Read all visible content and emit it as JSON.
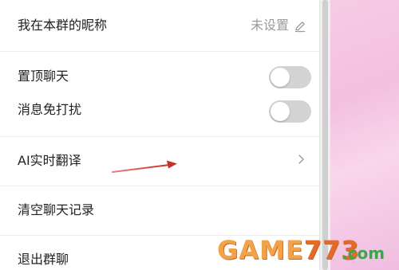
{
  "settings": {
    "nickname": {
      "label": "我在本群的昵称",
      "value": "未设置"
    },
    "pin_chat": {
      "label": "置顶聊天",
      "enabled": false
    },
    "do_not_disturb": {
      "label": "消息免打扰",
      "enabled": false
    },
    "ai_translate": {
      "label": "AI实时翻译"
    },
    "clear_history": {
      "label": "清空聊天记录"
    },
    "exit_group": {
      "label": "退出群聊"
    }
  },
  "icons": {
    "edit": "pencil-icon",
    "chevron": "chevron-right-icon",
    "annotation": "red-arrow"
  },
  "watermark": {
    "text_main": "GAME",
    "text_num": "773",
    "text_suffix": ".com"
  },
  "colors": {
    "toggle_off": "#d3d3d3",
    "annotation_arrow": "#c8312a",
    "background_pink": "#f3c0e0"
  }
}
